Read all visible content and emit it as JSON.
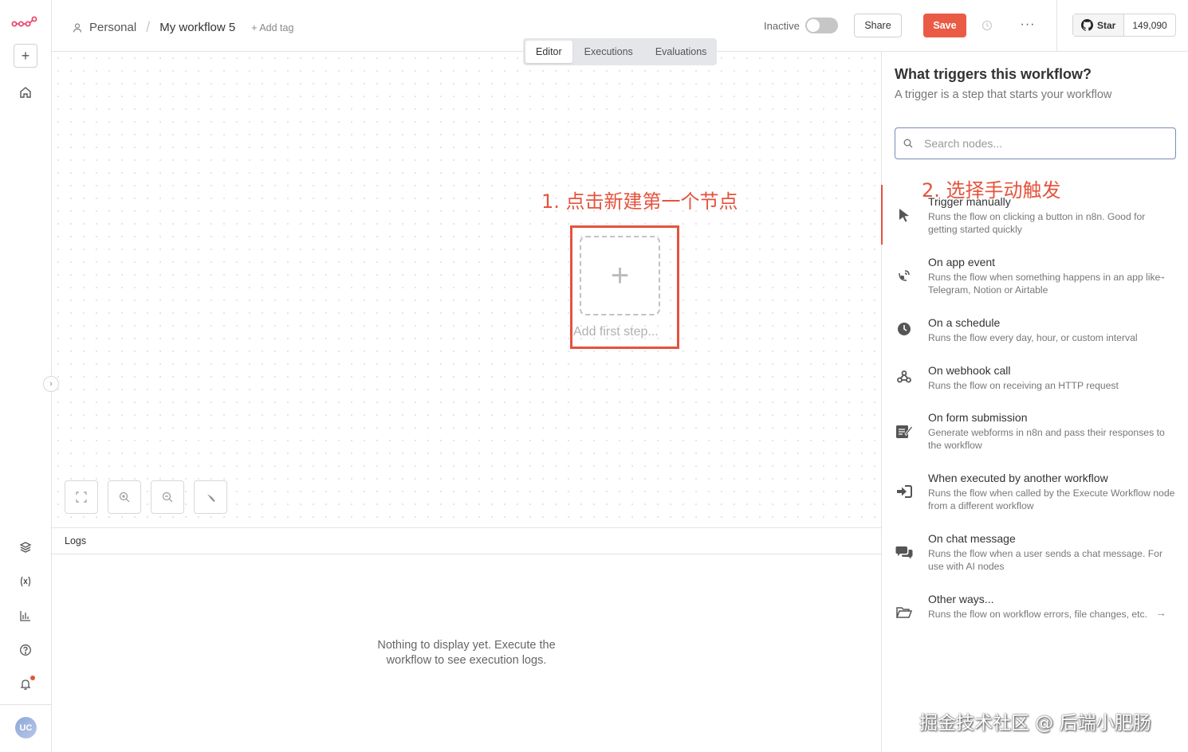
{
  "header": {
    "crumb_project": "Personal",
    "crumb_separator": "/",
    "workflow_name": "My workflow 5",
    "add_tag": "+ Add tag",
    "status_label": "Inactive",
    "share_label": "Share",
    "save_label": "Save",
    "more_label": "···",
    "github_star": "Star",
    "github_count": "149,090"
  },
  "tabs": [
    "Editor",
    "Executions",
    "Evaluations"
  ],
  "canvas": {
    "annotation_step1": "1. 点击新建第一个节点",
    "add_first_step": "Add first step...",
    "plus_glyph": "+"
  },
  "logs": {
    "title": "Logs",
    "empty_line1": "Nothing to display yet. Execute the",
    "empty_line2": "workflow to see execution logs."
  },
  "panel": {
    "title": "What triggers this workflow?",
    "subtitle": "A trigger is a step that starts your workflow",
    "search_placeholder": "Search nodes...",
    "annotation_step2": "2. 选择手动触发",
    "items": [
      {
        "name": "Trigger manually",
        "desc": "Runs the flow on clicking a button in n8n. Good for getting started quickly",
        "icon": "cursor-icon"
      },
      {
        "name": "On app event",
        "desc": "Runs the flow when something happens in an app like Telegram, Notion or Airtable",
        "icon": "satellite-dish-icon"
      },
      {
        "name": "On a schedule",
        "desc": "Runs the flow every day, hour, or custom interval",
        "icon": "clock-icon"
      },
      {
        "name": "On webhook call",
        "desc": "Runs the flow on receiving an HTTP request",
        "icon": "webhook-icon"
      },
      {
        "name": "On form submission",
        "desc": "Generate webforms in n8n and pass their responses to the workflow",
        "icon": "form-icon"
      },
      {
        "name": "When executed by another workflow",
        "desc": "Runs the flow when called by the Execute Workflow node from a different workflow",
        "icon": "sign-in-icon"
      },
      {
        "name": "On chat message",
        "desc": "Runs the flow when a user sends a chat message. For use with AI nodes",
        "icon": "chat-icon"
      },
      {
        "name": "Other ways...",
        "desc": "Runs the flow on workflow errors, file changes, etc.",
        "icon": "folder-icon"
      }
    ],
    "arrow_glyph": "→"
  },
  "sidebar": {
    "avatar_initials": "UC",
    "add_glyph": "+",
    "collapse_glyph": "›"
  },
  "watermark": "掘金技术社区 @ 后端小肥肠",
  "colors": {
    "accent": "#ea5b45",
    "annotation": "#e5533d"
  }
}
